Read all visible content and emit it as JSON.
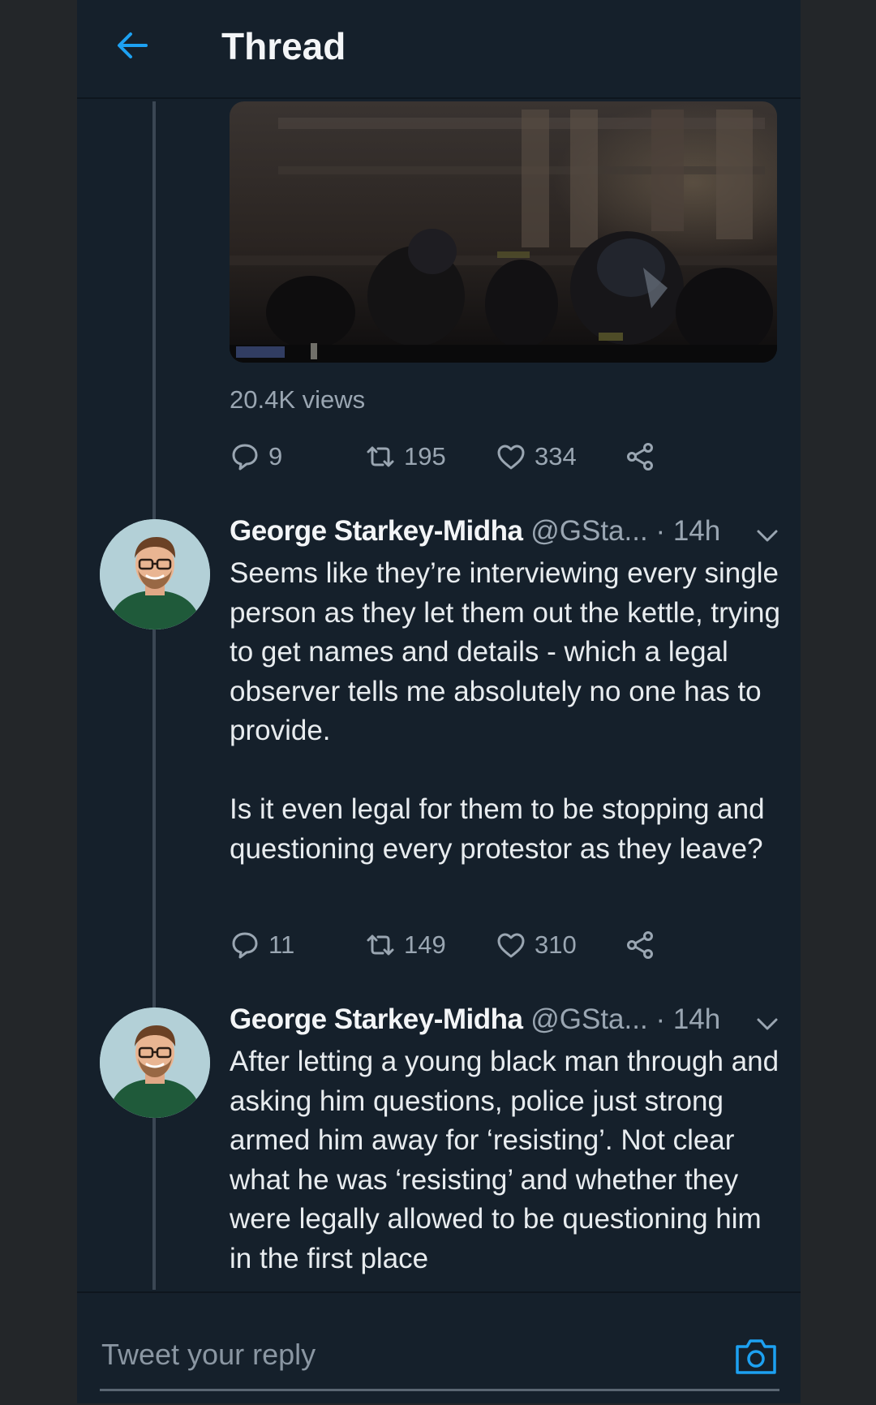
{
  "header": {
    "title": "Thread",
    "back_icon": "arrow-left-icon"
  },
  "colors": {
    "background": "#15202b",
    "accent": "#1da1f2",
    "secondary_text": "#9aa6b2"
  },
  "first_tweet": {
    "views": "20.4K views",
    "actions": {
      "reply_count": "9",
      "retweet_count": "195",
      "like_count": "334"
    }
  },
  "tweets": [
    {
      "author": "George Starkey-Midha",
      "handle": "@GSta...",
      "separator": "·",
      "time": "14h",
      "paragraphs": [
        "Seems like they’re interviewing every single person as they let them out the kettle, trying to get names and details - which a legal observer tells me absolutely no one has to provide.",
        "Is it even legal for them to be stopping and questioning every protestor as they leave?"
      ],
      "actions": {
        "reply_count": "11",
        "retweet_count": "149",
        "like_count": "310"
      }
    },
    {
      "author": "George Starkey-Midha",
      "handle": "@GSta...",
      "separator": "·",
      "time": "14h",
      "paragraphs": [
        "After letting a young black man through and asking him questions, police just strong armed him away for ‘resisting’. Not clear what he was ‘resisting’ and whether they were legally allowed to be questioning him in the first place"
      ]
    }
  ],
  "reply": {
    "placeholder": "Tweet your reply",
    "camera_icon": "camera-icon"
  }
}
